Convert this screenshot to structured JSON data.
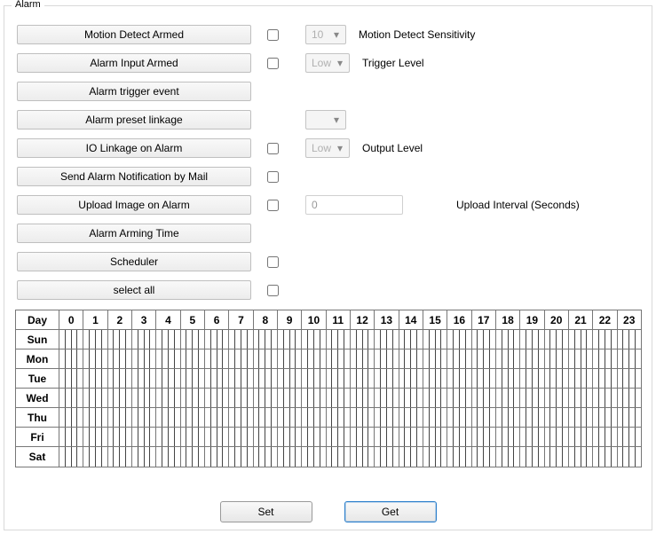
{
  "panel": {
    "title": "Alarm"
  },
  "rows": {
    "motion_detect_armed": "Motion Detect Armed",
    "motion_detect_sensitivity_select": "10",
    "motion_detect_sensitivity_label": "Motion Detect Sensitivity",
    "alarm_input_armed": "Alarm Input Armed",
    "trigger_level_select": "Low",
    "trigger_level_label": "Trigger Level",
    "alarm_trigger_event": "Alarm trigger event",
    "alarm_preset_linkage": "Alarm preset linkage",
    "preset_select": "",
    "io_linkage": "IO Linkage on Alarm",
    "output_level_select": "Low",
    "output_level_label": "Output Level",
    "send_mail": "Send Alarm Notification by Mail",
    "upload_image": "Upload Image on Alarm",
    "upload_interval_value": "0",
    "upload_interval_label": "Upload Interval (Seconds)",
    "arming_time": "Alarm Arming Time",
    "scheduler": "Scheduler",
    "select_all": "select all"
  },
  "schedule": {
    "day_header": "Day",
    "hours": [
      "0",
      "1",
      "2",
      "3",
      "4",
      "5",
      "6",
      "7",
      "8",
      "9",
      "10",
      "11",
      "12",
      "13",
      "14",
      "15",
      "16",
      "17",
      "18",
      "19",
      "20",
      "21",
      "22",
      "23"
    ],
    "days": [
      "Sun",
      "Mon",
      "Tue",
      "Wed",
      "Thu",
      "Fri",
      "Sat"
    ]
  },
  "buttons": {
    "set": "Set",
    "get": "Get"
  }
}
